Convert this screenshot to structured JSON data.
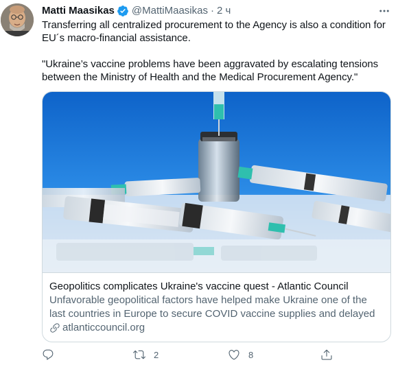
{
  "author": {
    "display_name": "Matti Maasikas",
    "handle": "@MattiMaasikas",
    "separator": "·",
    "time": "2 ч",
    "verified": true
  },
  "tweet": {
    "paragraph_1": "Transferring all centralized procurement to the Agency is also a condition for EU´s macro-financial assistance.",
    "paragraph_2": "\"Ukraine’s vaccine problems have been aggravated by escalating tensions between the Ministry of Health and the Medical Procurement Agency.\""
  },
  "card": {
    "title": "Geopolitics complicates Ukraine's vaccine quest - Atlantic Council",
    "description": "Unfavorable geopolitical factors have helped make Ukraine one of the last countries in Europe to secure COVID vaccine supplies and delayed …",
    "domain": "atlanticcouncil.org"
  },
  "actions": {
    "reply": {
      "icon": "reply-icon",
      "count": ""
    },
    "retweet": {
      "icon": "retweet-icon",
      "count": "2"
    },
    "like": {
      "icon": "like-icon",
      "count": "8"
    },
    "share": {
      "icon": "share-icon",
      "count": ""
    }
  },
  "colors": {
    "text": "#0f1419",
    "secondary": "#536471",
    "border": "#cfd9de",
    "verified": "#1d9bf0"
  }
}
